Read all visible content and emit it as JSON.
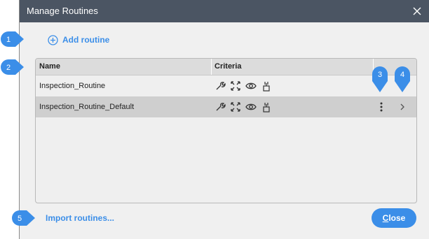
{
  "dialog": {
    "title": "Manage Routines",
    "close_icon": "close-icon"
  },
  "toolbar": {
    "add_label": "Add routine",
    "add_icon": "plus-circle-icon"
  },
  "table": {
    "headers": [
      "Name",
      "Criteria"
    ],
    "rows": [
      {
        "name": "Inspection_Routine",
        "criteria_icons": [
          "wrench-icon",
          "expand-icon",
          "eye-icon",
          "pin-icon"
        ]
      },
      {
        "name": "Inspection_Routine_Default",
        "criteria_icons": [
          "wrench-icon",
          "expand-icon",
          "eye-icon",
          "pin-icon"
        ],
        "selected": true,
        "actions": [
          "kebab-menu-icon",
          "chevron-right-icon"
        ]
      }
    ]
  },
  "footer": {
    "import_label": "Import routines...",
    "close_label": "Close",
    "close_label_underlined": "C",
    "close_label_rest": "lose"
  },
  "callouts": [
    "1",
    "2",
    "3",
    "4",
    "5"
  ],
  "colors": {
    "accent": "#3b8ee8",
    "titlebar": "#4b5563",
    "selected_row": "#cfcfcf"
  }
}
